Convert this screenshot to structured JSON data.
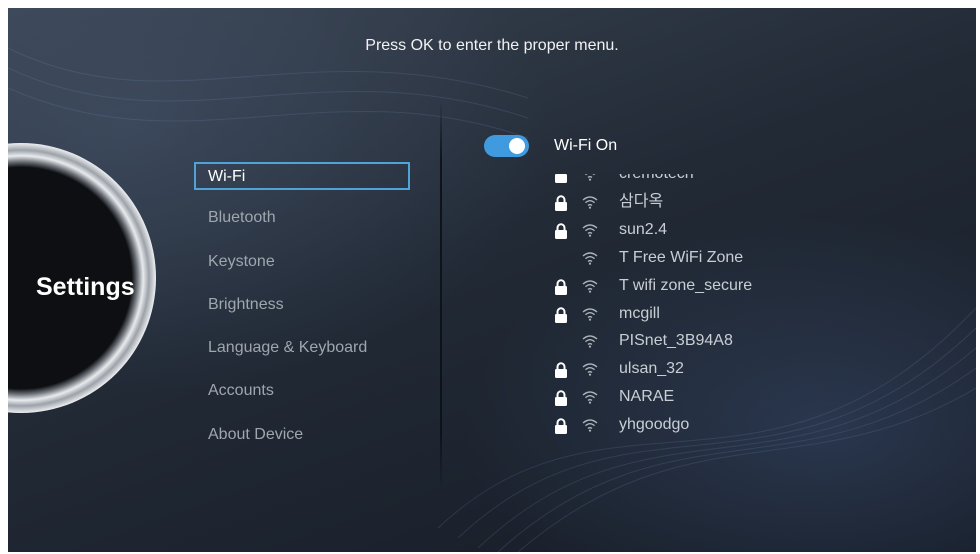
{
  "header": {
    "hint": "Press OK to enter the proper menu."
  },
  "sidebar": {
    "title": "Settings"
  },
  "menu": {
    "items": [
      {
        "label": "Wi-Fi",
        "selected": true
      },
      {
        "label": "Bluetooth",
        "selected": false
      },
      {
        "label": "Keystone",
        "selected": false
      },
      {
        "label": "Brightness",
        "selected": false
      },
      {
        "label": "Language & Keyboard",
        "selected": false
      },
      {
        "label": "Accounts",
        "selected": false
      },
      {
        "label": "About Device",
        "selected": false
      }
    ]
  },
  "wifi": {
    "toggle_label": "Wi-Fi On",
    "enabled": true,
    "accent_color": "#3f9ae0",
    "networks": [
      {
        "ssid": "cremotech",
        "secured": true
      },
      {
        "ssid": "삼다옥",
        "secured": true
      },
      {
        "ssid": "sun2.4",
        "secured": true
      },
      {
        "ssid": "T Free WiFi Zone",
        "secured": false
      },
      {
        "ssid": "T wifi zone_secure",
        "secured": true
      },
      {
        "ssid": "mcgill",
        "secured": true
      },
      {
        "ssid": "PISnet_3B94A8",
        "secured": false
      },
      {
        "ssid": "ulsan_32",
        "secured": true
      },
      {
        "ssid": "NARAE",
        "secured": true
      },
      {
        "ssid": "yhgoodgo",
        "secured": true
      }
    ]
  },
  "icons": {
    "lock": "lock-icon",
    "wifi": "wifi-signal-icon"
  }
}
